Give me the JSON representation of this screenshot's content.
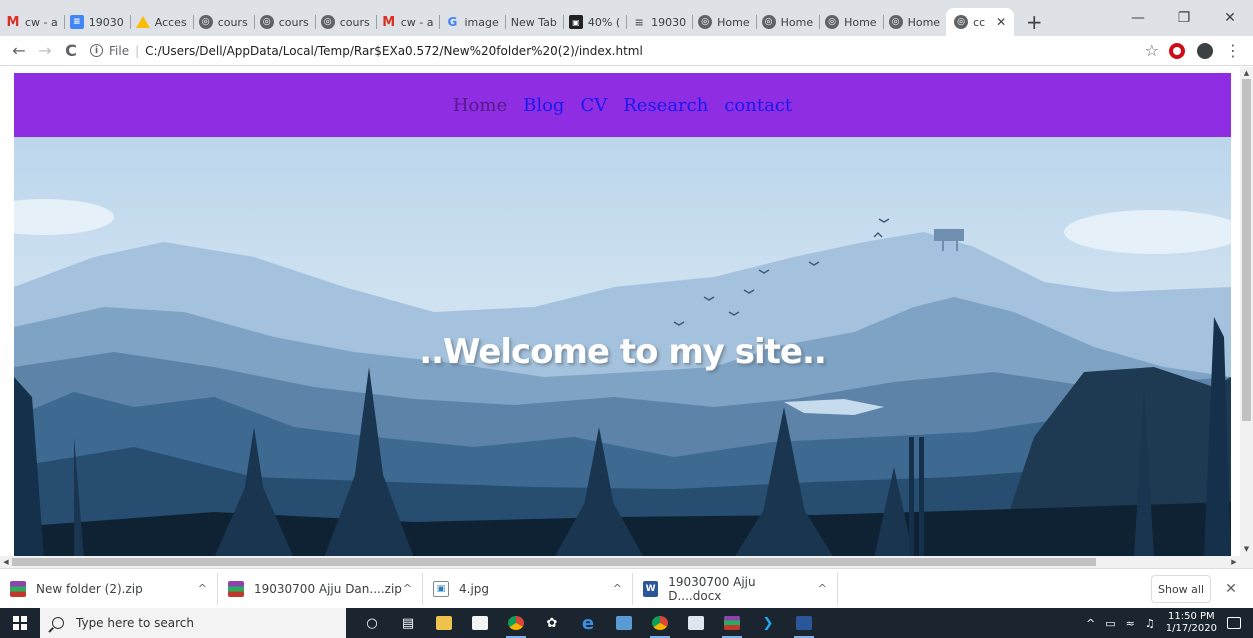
{
  "browser": {
    "tabs": [
      {
        "icon": "gmail-icon",
        "label": "cw - a"
      },
      {
        "icon": "google-docs-icon",
        "label": "19030"
      },
      {
        "icon": "google-drive-icon",
        "label": "Acces"
      },
      {
        "icon": "globe-icon",
        "label": "cours"
      },
      {
        "icon": "globe-icon",
        "label": "cours"
      },
      {
        "icon": "globe-icon",
        "label": "cours"
      },
      {
        "icon": "gmail-icon",
        "label": "cw - a"
      },
      {
        "icon": "google-icon",
        "label": "image"
      },
      {
        "icon": "",
        "label": "New Tab"
      },
      {
        "icon": "image-icon",
        "label": "40% ("
      },
      {
        "icon": "list-icon",
        "label": "19030"
      },
      {
        "icon": "globe-icon",
        "label": "Home"
      },
      {
        "icon": "globe-icon",
        "label": "Home"
      },
      {
        "icon": "globe-icon",
        "label": "Home"
      },
      {
        "icon": "globe-icon",
        "label": "Home"
      },
      {
        "icon": "globe-icon",
        "label": "cc",
        "active": true
      }
    ],
    "new_tab_label": "+",
    "address": {
      "scheme_label": "File",
      "url": "C:/Users/Dell/AppData/Local/Temp/Rar$EXa0.572/New%20folder%20(2)/index.html"
    }
  },
  "site": {
    "nav": [
      "Home",
      "Blog",
      "CV",
      "Research",
      "contact"
    ],
    "welcome": "..Welcome to my site..",
    "colors": {
      "nav_bg": "#8e2de2",
      "link": "#1a1aee",
      "visited": "#551a8b"
    }
  },
  "downloads": {
    "items": [
      {
        "type": "zip",
        "name": "New folder (2).zip"
      },
      {
        "type": "zip",
        "name": "19030700 Ajju Dan....zip"
      },
      {
        "type": "jpg",
        "name": "4.jpg"
      },
      {
        "type": "docx",
        "name": "19030700 Ajju D....docx"
      }
    ],
    "show_all": "Show all"
  },
  "taskbar": {
    "search_placeholder": "Type here to search",
    "time": "11:50 PM",
    "date": "1/17/2020"
  }
}
